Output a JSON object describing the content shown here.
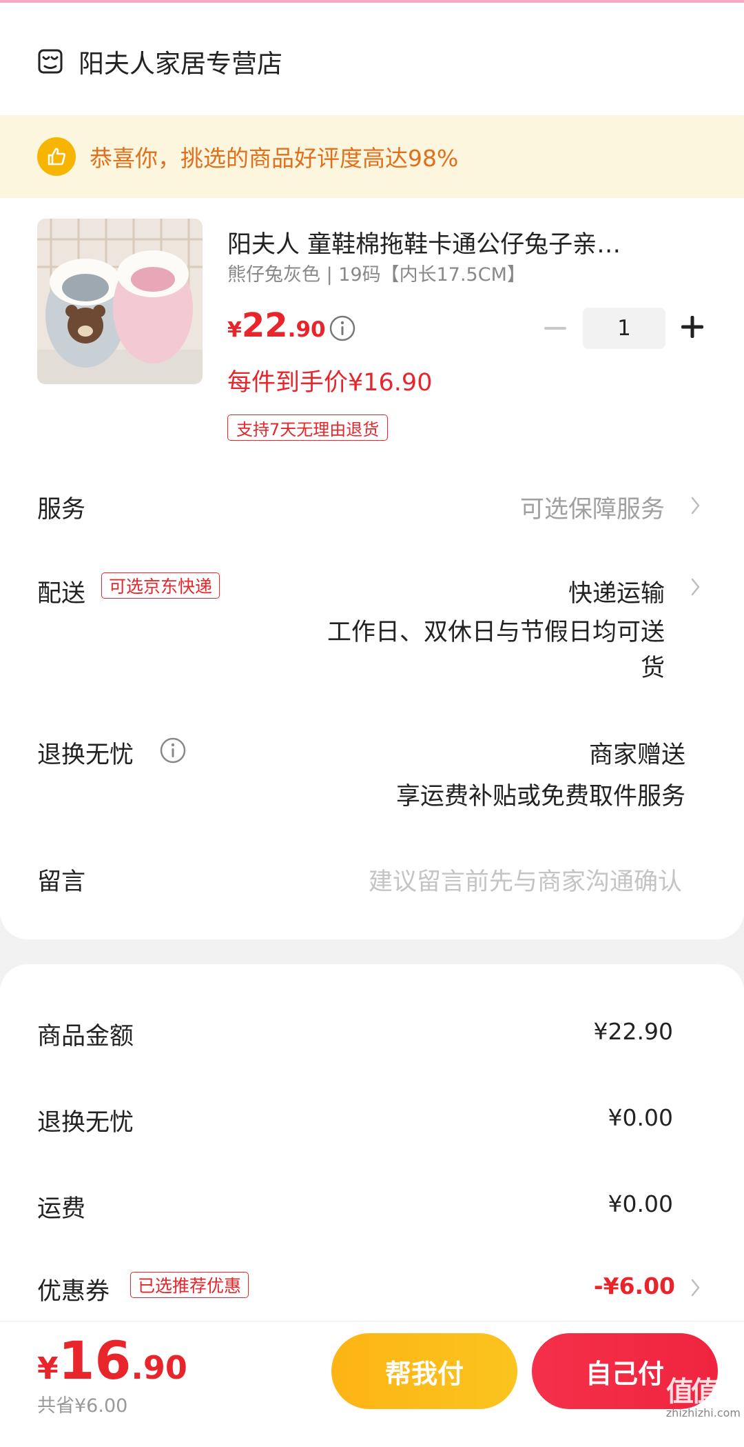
{
  "store": {
    "name": "阳夫人家居专营店"
  },
  "banner": {
    "text": "恭喜你，挑选的商品好评度高达98%"
  },
  "product": {
    "title": "阳夫人 童鞋棉拖鞋卡通公仔兔子亲…",
    "spec": "熊仔兔灰色 | 19码【内长17.5CM】",
    "price_currency": "¥",
    "price_int": "22",
    "price_dec": ".90",
    "quantity": "1",
    "final_price": "每件到手价¥16.90",
    "return_tag": "支持7天无理由退货"
  },
  "service": {
    "label": "服务",
    "value": "可选保障服务"
  },
  "delivery": {
    "label": "配送",
    "tag": "可选京东快递",
    "method": "快递运输",
    "note_line1": "工作日、双休日与节假日均可送",
    "note_line2": "货"
  },
  "returns": {
    "label": "退换无忧",
    "value": "商家赠送",
    "note": "享运费补贴或免费取件服务"
  },
  "message": {
    "label": "留言",
    "placeholder": "建议留言前先与商家沟通确认"
  },
  "summary": {
    "goods_label": "商品金额",
    "goods_value": "¥22.90",
    "returns_label": "退换无忧",
    "returns_value": "¥0.00",
    "shipping_label": "运费",
    "shipping_value": "¥0.00",
    "coupon_label": "优惠券",
    "coupon_tag": "已选推荐优惠",
    "coupon_value": "-¥6.00"
  },
  "footer": {
    "total_currency": "¥",
    "total_int": "16",
    "total_dec": ".90",
    "saved": "共省¥6.00",
    "help_pay": "帮我付",
    "self_pay": "自己付"
  },
  "watermark": {
    "logo": "值值值",
    "site": "zhizhizhi.com"
  },
  "colors": {
    "accent_red": "#e8252a",
    "banner_bg": "#fdf6df",
    "banner_text": "#e0701c",
    "help_btn": "#fdb414",
    "self_btn": "#f0243e"
  }
}
